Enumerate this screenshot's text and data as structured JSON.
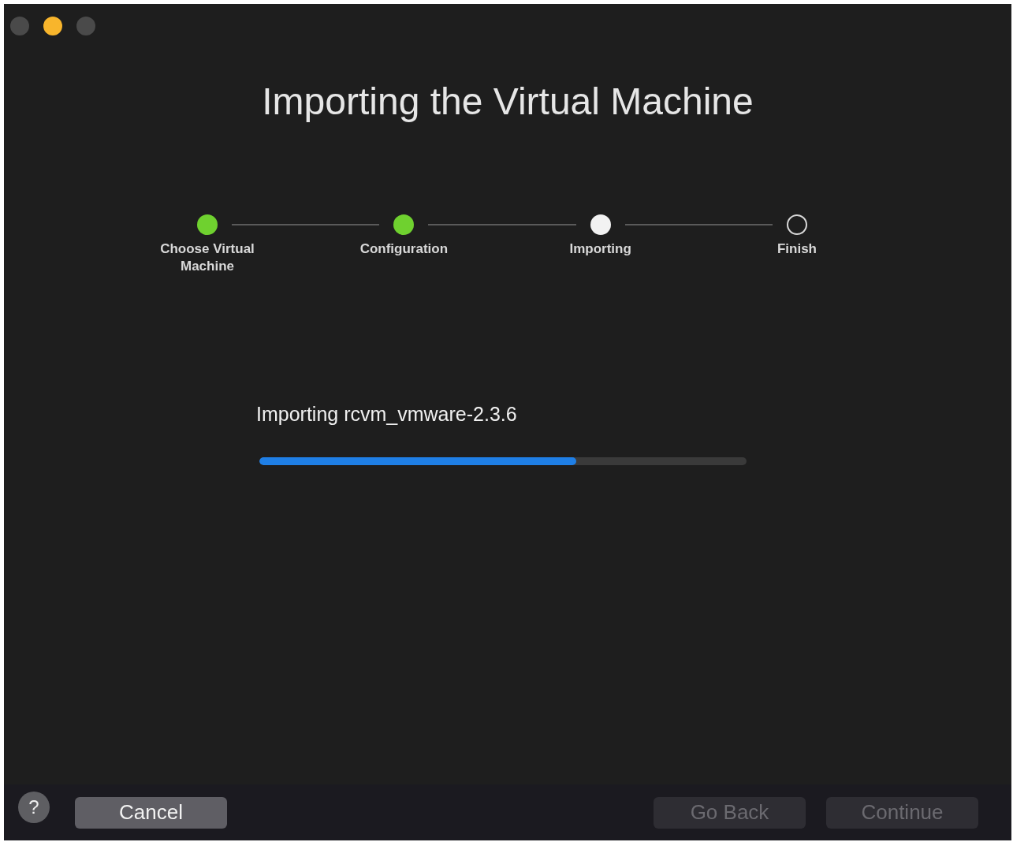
{
  "window": {
    "title": "Importing the Virtual Machine",
    "traffic_lights": [
      {
        "kind": "inactive"
      },
      {
        "kind": "minimize"
      },
      {
        "kind": "inactive"
      }
    ]
  },
  "steps": [
    {
      "label": "Choose Virtual Machine",
      "kind": "done"
    },
    {
      "label": "Configuration",
      "kind": "done"
    },
    {
      "label": "Importing",
      "kind": "current"
    },
    {
      "label": "Finish",
      "kind": "pending"
    }
  ],
  "progress": {
    "label": "Importing rcvm_vmware-2.3.6",
    "level": 0.65
  },
  "footer": {
    "help": "?",
    "buttons": [
      {
        "label": "Cancel",
        "disabled": false
      },
      {
        "label": "Go Back",
        "disabled": true
      },
      {
        "label": "Continue",
        "disabled": true
      }
    ]
  }
}
